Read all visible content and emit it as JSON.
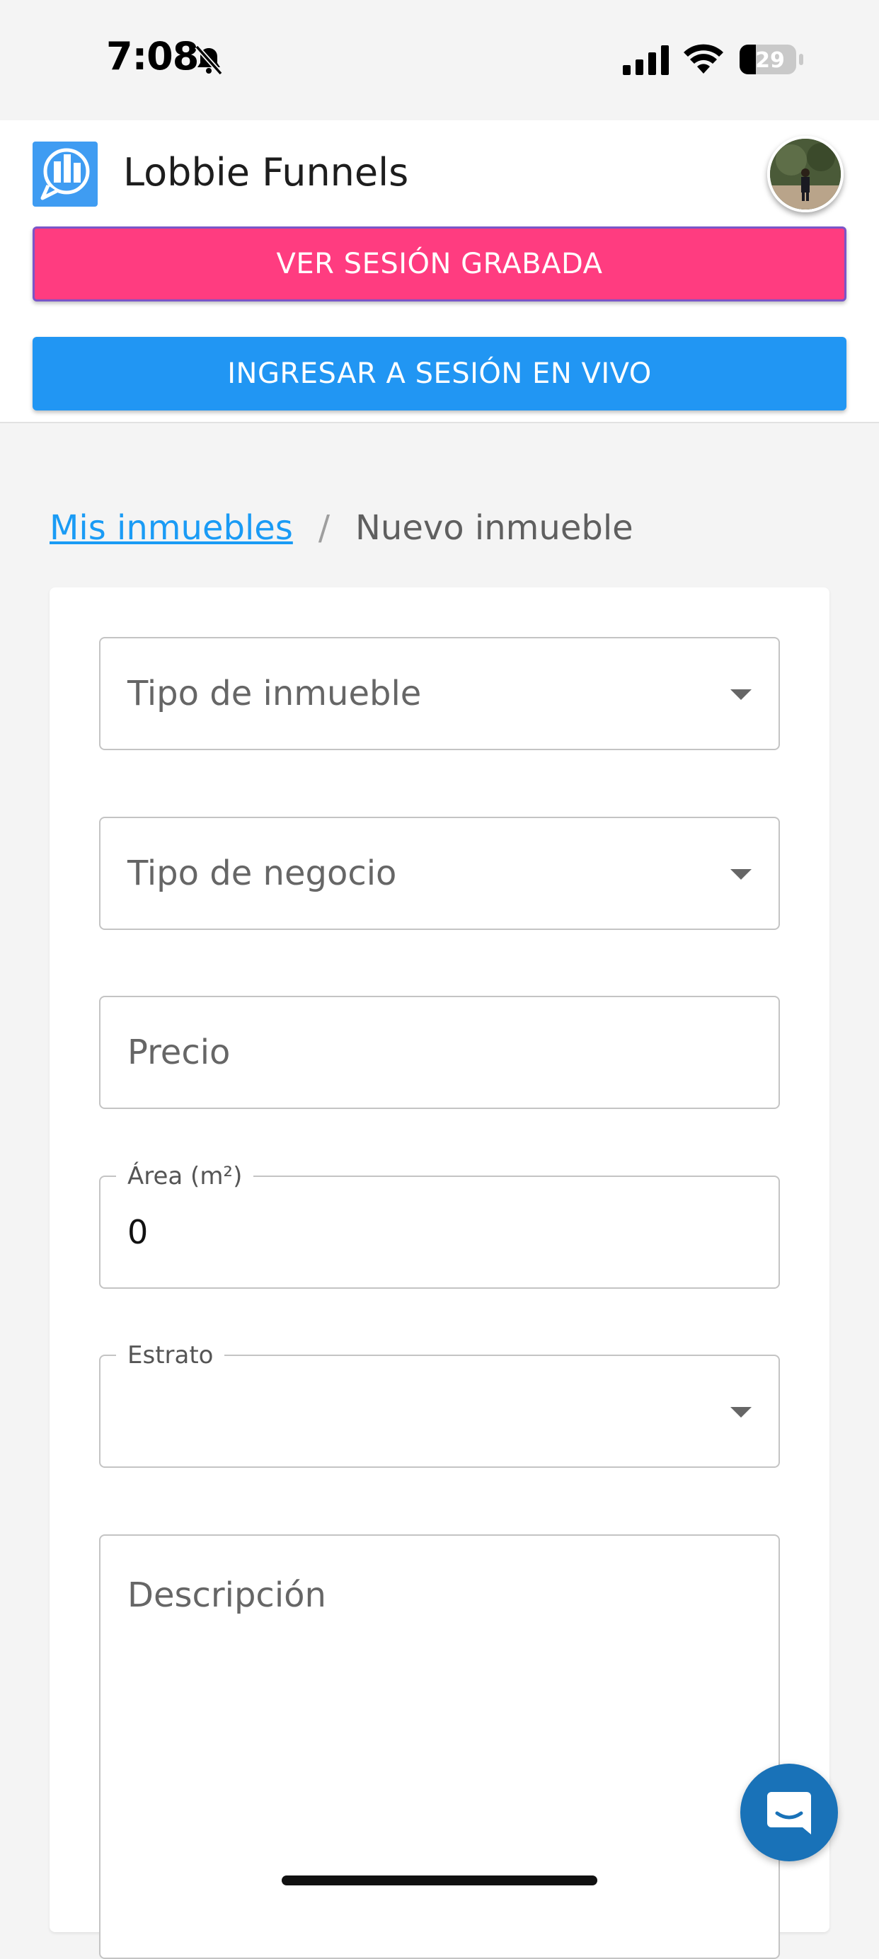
{
  "status_bar": {
    "time": "7:08",
    "battery_level": "29",
    "icons": [
      "bell-slash-icon",
      "cellular-signal-icon",
      "wifi-icon",
      "battery-icon"
    ]
  },
  "header": {
    "app_title": "Lobbie Funnels",
    "logo_icon": "building-chat-logo",
    "avatar": "user-avatar",
    "btn_recorded_label": "VER SESIÓN GRABADA",
    "btn_live_label": "INGRESAR A SESIÓN EN VIVO",
    "colors": {
      "recorded": "#ff3c80",
      "live": "#2196f3",
      "logo": "#3f9cf2"
    }
  },
  "breadcrumb": {
    "link": "Mis inmuebles",
    "separator": "/",
    "current": "Nuevo inmueble"
  },
  "form": {
    "tipo_inmueble": {
      "placeholder": "Tipo de inmueble"
    },
    "tipo_negocio": {
      "placeholder": "Tipo de negocio"
    },
    "precio": {
      "placeholder": "Precio"
    },
    "area": {
      "label": "Área (m²)",
      "value": "0"
    },
    "estrato": {
      "label": "Estrato",
      "value": ""
    },
    "descripcion": {
      "placeholder": "Descripción"
    }
  },
  "chat": {
    "icon": "chat-bubble-icon",
    "color": "#1972b8"
  }
}
